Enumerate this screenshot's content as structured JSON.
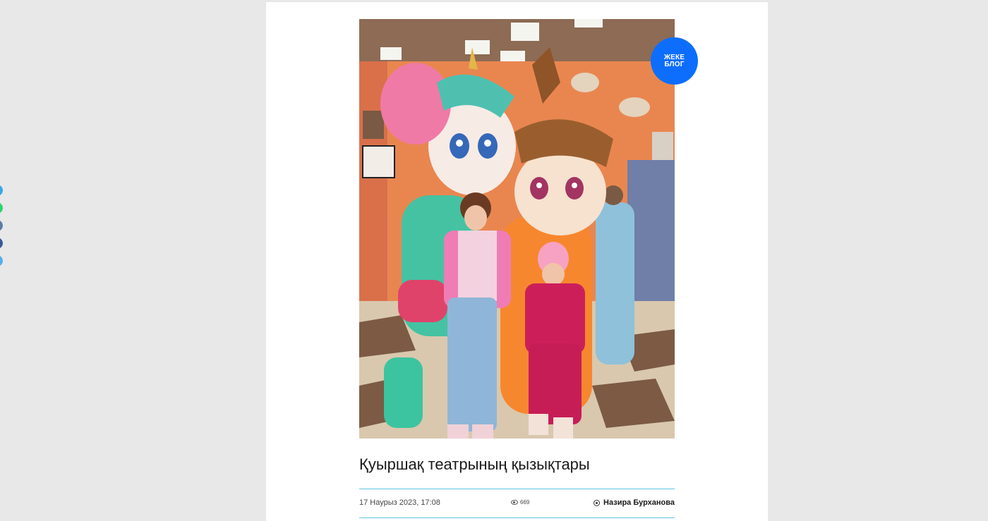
{
  "share": {
    "items": [
      "twitter-icon",
      "whatsapp-icon",
      "vk-icon",
      "facebook-icon",
      "telegram-icon"
    ]
  },
  "post": {
    "badge": "ЖЕКЕ\nБЛОГ",
    "title": "Қуыршақ театрының қызықтары",
    "date": "17 Наурыз 2023, 17:08",
    "views": "669",
    "author": "Назира Бурханова"
  },
  "colors": {
    "accent": "#0d6efd",
    "divider": "#5fc6e0"
  }
}
